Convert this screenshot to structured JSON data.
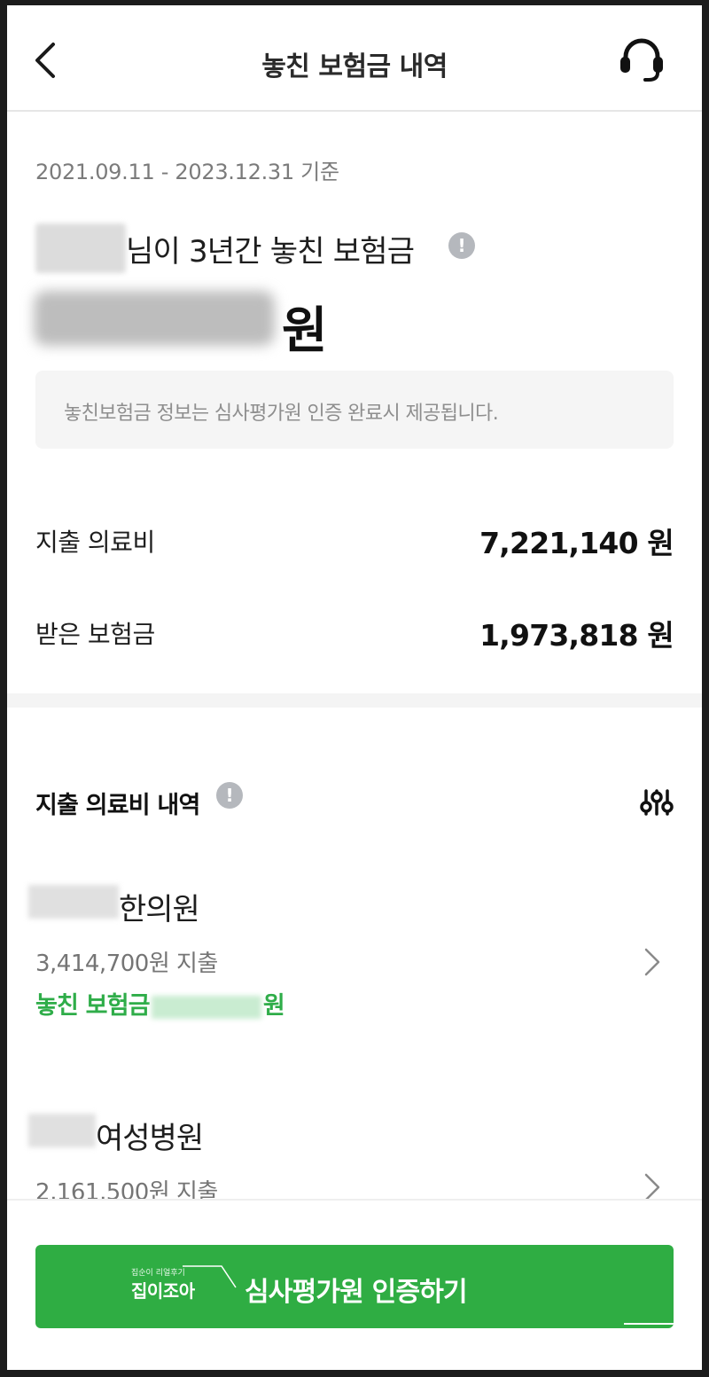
{
  "header": {
    "title": "놓친 보험금 내역",
    "back_icon": "chevron-left-icon",
    "support_icon": "headset-icon"
  },
  "summary": {
    "period": "2021.09.11 - 2023.12.31 기준",
    "headline_suffix": "님이 3년간 놓친 보험금",
    "amount_unit": "원",
    "notice": "놓친보험금 정보는 심사평가원 인증 완료시 제공됩니다."
  },
  "stats": [
    {
      "label": "지출 의료비",
      "value": "7,221,140 원"
    },
    {
      "label": "받은 보험금",
      "value": "1,973,818 원"
    }
  ],
  "section": {
    "title": "지출 의료비 내역",
    "filter_icon": "sliders-icon",
    "info_icon": "!"
  },
  "items": [
    {
      "name_visible": "한의원",
      "spent": "3,414,700원 지출",
      "missed_prefix": "놓친 보험금",
      "missed_suffix": "원"
    },
    {
      "name_visible": "여성병원",
      "spent": "2,161,500원 지출"
    }
  ],
  "cta": {
    "label": "심사평가원 인증하기",
    "watermark_small": "집순이 리얼후기",
    "watermark_big": "집이조아"
  },
  "colors": {
    "accent_green": "#2fad43",
    "text_primary": "#111111",
    "text_secondary": "#757575"
  }
}
